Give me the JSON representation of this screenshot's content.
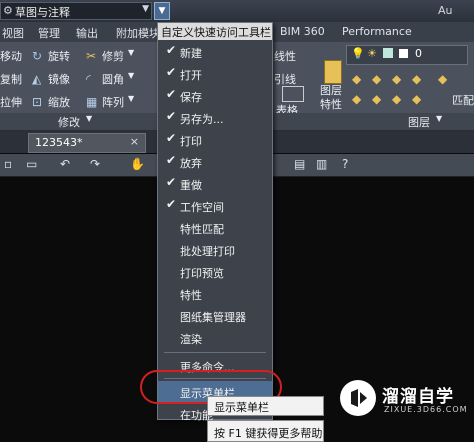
{
  "titlebar": {
    "workspace": "草图与注释",
    "app_name": "Au"
  },
  "ribbon_tabs": [
    "视图",
    "管理",
    "输出",
    "附加模块",
    "BIM 360",
    "Performance"
  ],
  "ribbon": {
    "modify": {
      "items": [
        "移动",
        "旋转",
        "修剪",
        "复制",
        "镜像",
        "圆角",
        "拉伸",
        "缩放",
        "阵列"
      ],
      "title": "修改"
    },
    "annotation": {
      "items": [
        "线性",
        "引线",
        "表格"
      ]
    },
    "layers": {
      "layer_value": "0",
      "properties_label": "图层特性",
      "match_label": "匹配",
      "title": "图层"
    }
  },
  "file_tab": {
    "name": "123543*",
    "close": "×"
  },
  "qat_menu": {
    "header": "自定义快速访问工具栏",
    "items": [
      {
        "label": "新建",
        "checked": true
      },
      {
        "label": "打开",
        "checked": true
      },
      {
        "label": "保存",
        "checked": true
      },
      {
        "label": "另存为...",
        "checked": true
      },
      {
        "label": "打印",
        "checked": true
      },
      {
        "label": "放弃",
        "checked": true
      },
      {
        "label": "重做",
        "checked": true
      },
      {
        "label": "工作空间",
        "checked": true
      },
      {
        "label": "特性匹配",
        "checked": false
      },
      {
        "label": "批处理打印",
        "checked": false
      },
      {
        "label": "打印预览",
        "checked": false
      },
      {
        "label": "特性",
        "checked": false
      },
      {
        "label": "图纸集管理器",
        "checked": false
      },
      {
        "label": "渲染",
        "checked": false
      },
      {
        "label": "更多命令...",
        "checked": false
      },
      {
        "label": "显示菜单栏",
        "checked": false
      },
      {
        "label": "在功能",
        "checked": false
      }
    ]
  },
  "tooltip": {
    "title": "显示菜单栏",
    "help": "按 F1 键获得更多帮助"
  },
  "watermark": {
    "main": "溜溜自学",
    "sub": "ZIXUE.3D66.COM"
  },
  "colors": {
    "highlight_oval": "#d61f1f",
    "menu_bg": "#3d424b",
    "selected_item": "#4e6d92"
  }
}
